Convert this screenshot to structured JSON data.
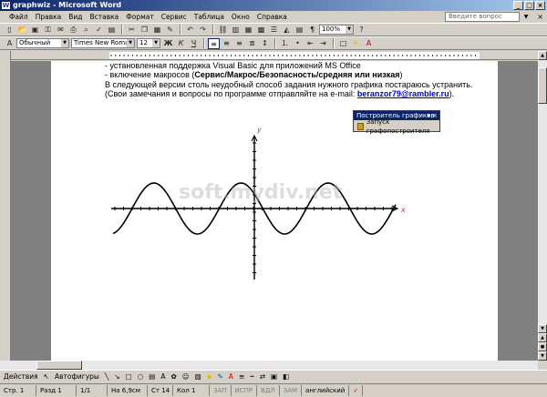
{
  "window": {
    "title": "graphwiz - Microsoft Word"
  },
  "menu": {
    "items": [
      "Файл",
      "Правка",
      "Вид",
      "Вставка",
      "Формат",
      "Сервис",
      "Таблица",
      "Окно",
      "Справка"
    ],
    "help_placeholder": "Введите вопрос"
  },
  "toolbar": {
    "zoom": "100%",
    "style": "Обычный",
    "font": "Times New Roman",
    "size": "12",
    "icons": [
      "new-icon",
      "open-icon",
      "save-icon",
      "permission-icon",
      "email-icon",
      "print-icon",
      "preview-icon",
      "spelling-icon",
      "research-icon",
      "cut-icon",
      "copy-icon",
      "paste-icon",
      "format-painter-icon",
      "undo-icon",
      "redo-icon",
      "hyperlink-icon",
      "tables-icon",
      "insert-table-icon",
      "excel-icon",
      "columns-icon",
      "drawing-icon",
      "docmap-icon",
      "show-all-icon"
    ]
  },
  "document": {
    "lines": [
      "- установленная поддержка Visual Basic для приложений MS Office",
      "- включение макросов (",
      "Сервис/Макрос/Безопасность/средняя или низкая",
      ")",
      "В следующей версии столь неудобный способ задания нужного графика постараюсь устранить.",
      "(Свои замечания и вопросы по программе отправляйте на e-mail: ",
      "beranzor79@rambler.ru",
      ")."
    ],
    "watermark": "soft.mydiv.net",
    "graph": {
      "x_label": "x",
      "y_label": "y"
    }
  },
  "floating_toolbar": {
    "title": "Построитель графиков",
    "button": "Запуск графопостроителя"
  },
  "drawbar": {
    "actions": "Действия",
    "autoshapes": "Автофигуры"
  },
  "status": {
    "page": "Стр. 1",
    "section": "Разд 1",
    "pages": "1/1",
    "position": "На 6,9см",
    "line": "Ст 14",
    "col": "Кол 1",
    "rec": "ЗАП",
    "trk": "ИСПР",
    "ext": "ВДЛ",
    "ovr": "ЗАМ",
    "lang": "английский"
  },
  "colors": {
    "title_start": "#0a246a",
    "title_end": "#a6caf0",
    "link": "#0000cc"
  }
}
